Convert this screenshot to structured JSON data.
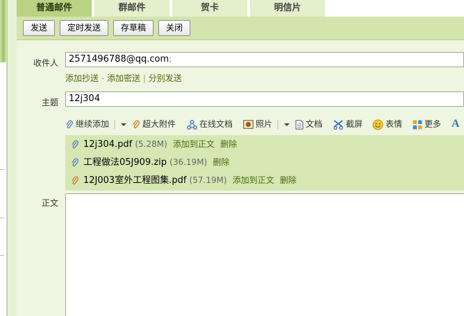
{
  "tabs": [
    {
      "label": "普通邮件",
      "active": true
    },
    {
      "label": "群邮件",
      "active": false
    },
    {
      "label": "贺卡",
      "active": false
    },
    {
      "label": "明信片",
      "active": false
    }
  ],
  "toolbar": {
    "send": "发送",
    "scheduled_send": "定时发送",
    "save_draft": "存草稿",
    "close": "关闭"
  },
  "recipient": {
    "label": "收件人",
    "value": "2571496788@qq.com",
    "separator": ";"
  },
  "cc_links": {
    "add_cc": "添加抄送",
    "dash": "-",
    "add_bcc": "添加密送",
    "pipe": "|",
    "separate_send": "分别发送"
  },
  "subject": {
    "label": "主题",
    "value": "12j304"
  },
  "edit_toolbar": {
    "continue_add": "继续添加",
    "large_attachment": "超大附件",
    "online_doc": "在线文档",
    "photo": "照片",
    "document": "文档",
    "screenshot": "截屏",
    "emoji": "表情",
    "more": "更多",
    "font_glyph": "A"
  },
  "attachments": [
    {
      "name": "12j304.pdf",
      "size": "(5.28M)",
      "add_to_body": "添加到正文",
      "delete": "删除"
    },
    {
      "name": "工程做法05J909.zip",
      "size": "(36.19M)",
      "add_to_body": "",
      "delete": "删除"
    },
    {
      "name": "12J003室外工程图集.pdf",
      "size": "(57.19M)",
      "add_to_body": "添加到正文",
      "delete": "删除"
    }
  ],
  "body": {
    "label": "正文"
  },
  "colors": {
    "accent_green": "#b9d283",
    "panel_green": "#eef5e0",
    "link_green": "#4d6b10",
    "clip_blue": "#5b7bbf",
    "clip_orange": "#d27a2c"
  }
}
